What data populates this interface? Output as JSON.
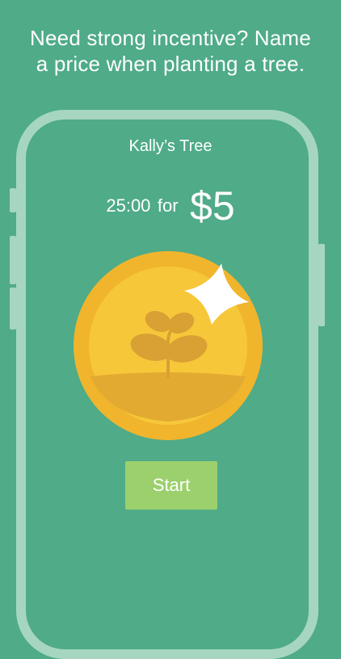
{
  "headline": {
    "line1": "Need strong incentive? Name",
    "line2": "a price when planting a tree."
  },
  "screen": {
    "tree_name": "Kally’s Tree",
    "duration": "25:00",
    "for_word": "for",
    "amount": "$5",
    "start_label": "Start"
  },
  "icons": {
    "coin": "gold-coin-icon",
    "sprout": "sprout-icon",
    "sparkle": "sparkle-icon"
  },
  "colors": {
    "background": "#4fab88",
    "frame": "#a7d6c0",
    "coin_outer": "#f0b52d",
    "coin_inner": "#f7c73a",
    "sprout": "#d9a033",
    "start_button": "#9bd06d"
  }
}
